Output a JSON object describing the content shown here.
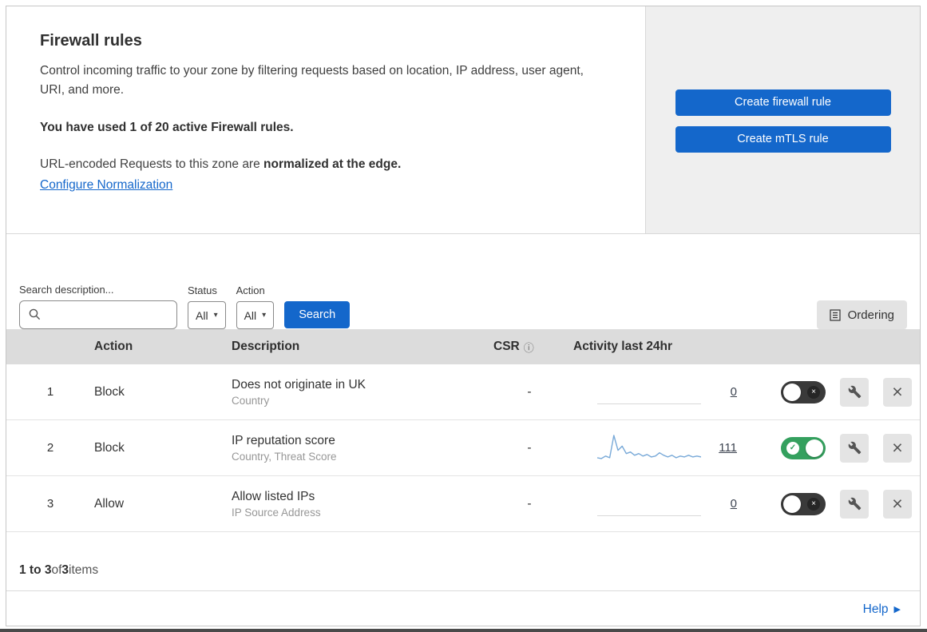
{
  "header": {
    "title": "Firewall rules",
    "description": "Control incoming traffic to your zone by filtering requests based on location, IP address, user agent, URI, and more.",
    "usage": "You have used 1 of 20 active Firewall rules.",
    "normalization": {
      "prefix": "URL-encoded Requests to this zone are ",
      "bold": "normalized at the edge.",
      "link": "Configure Normalization"
    },
    "actions": {
      "create_firewall_rule": "Create firewall rule",
      "create_mtls_rule": "Create mTLS rule"
    }
  },
  "filters": {
    "search_label": "Search description...",
    "status": {
      "label": "Status",
      "value": "All"
    },
    "action": {
      "label": "Action",
      "value": "All"
    },
    "search_button": "Search",
    "ordering_button": "Ordering"
  },
  "table": {
    "headers": {
      "action": "Action",
      "description": "Description",
      "csr": "CSR",
      "activity": "Activity last 24hr"
    },
    "rows": [
      {
        "priority": "1",
        "action": "Block",
        "description": "Does not originate in UK",
        "match_fields": "Country",
        "csr": "-",
        "activity_count": "0",
        "enabled": false,
        "sparkline": []
      },
      {
        "priority": "2",
        "action": "Block",
        "description": "IP reputation score",
        "match_fields": "Country, Threat Score",
        "csr": "-",
        "activity_count": "111",
        "enabled": true,
        "sparkline": [
          3,
          2,
          5,
          3,
          30,
          12,
          17,
          8,
          10,
          6,
          8,
          5,
          7,
          4,
          5,
          9,
          6,
          4,
          6,
          3,
          5,
          4,
          6,
          4,
          5,
          4
        ]
      },
      {
        "priority": "3",
        "action": "Allow",
        "description": "Allow listed IPs",
        "match_fields": "IP Source Address",
        "csr": "-",
        "activity_count": "0",
        "enabled": false,
        "sparkline": []
      }
    ]
  },
  "footer": {
    "range": "1 to 3",
    "of": " of ",
    "total": "3",
    "items": " items"
  },
  "help_link": "Help",
  "colors": {
    "accent_blue": "#1467cb",
    "toggle_on_green": "#34a05e",
    "toggle_off_dark": "#3a3a3a",
    "sparkline_blue": "#78a9d8",
    "table_header_bg": "#dcdcdc",
    "panel_bg": "#efefef"
  }
}
